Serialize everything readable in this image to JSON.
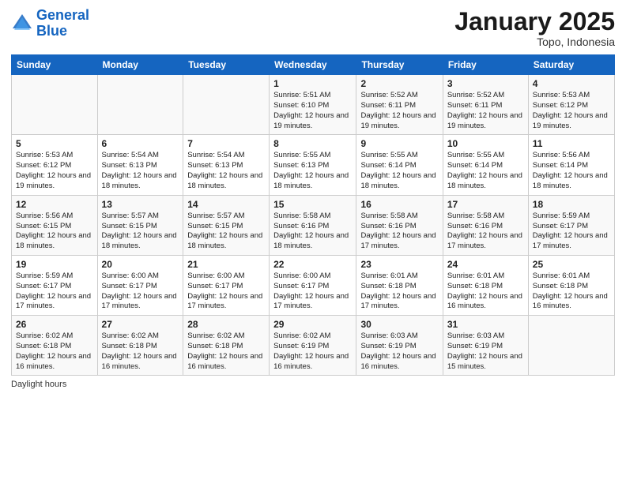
{
  "logo": {
    "line1": "General",
    "line2": "Blue"
  },
  "title": "January 2025",
  "subtitle": "Topo, Indonesia",
  "days_header": [
    "Sunday",
    "Monday",
    "Tuesday",
    "Wednesday",
    "Thursday",
    "Friday",
    "Saturday"
  ],
  "weeks": [
    [
      {
        "day": "",
        "detail": ""
      },
      {
        "day": "",
        "detail": ""
      },
      {
        "day": "",
        "detail": ""
      },
      {
        "day": "1",
        "detail": "Sunrise: 5:51 AM\nSunset: 6:10 PM\nDaylight: 12 hours\nand 19 minutes."
      },
      {
        "day": "2",
        "detail": "Sunrise: 5:52 AM\nSunset: 6:11 PM\nDaylight: 12 hours\nand 19 minutes."
      },
      {
        "day": "3",
        "detail": "Sunrise: 5:52 AM\nSunset: 6:11 PM\nDaylight: 12 hours\nand 19 minutes."
      },
      {
        "day": "4",
        "detail": "Sunrise: 5:53 AM\nSunset: 6:12 PM\nDaylight: 12 hours\nand 19 minutes."
      }
    ],
    [
      {
        "day": "5",
        "detail": "Sunrise: 5:53 AM\nSunset: 6:12 PM\nDaylight: 12 hours\nand 19 minutes."
      },
      {
        "day": "6",
        "detail": "Sunrise: 5:54 AM\nSunset: 6:13 PM\nDaylight: 12 hours\nand 18 minutes."
      },
      {
        "day": "7",
        "detail": "Sunrise: 5:54 AM\nSunset: 6:13 PM\nDaylight: 12 hours\nand 18 minutes."
      },
      {
        "day": "8",
        "detail": "Sunrise: 5:55 AM\nSunset: 6:13 PM\nDaylight: 12 hours\nand 18 minutes."
      },
      {
        "day": "9",
        "detail": "Sunrise: 5:55 AM\nSunset: 6:14 PM\nDaylight: 12 hours\nand 18 minutes."
      },
      {
        "day": "10",
        "detail": "Sunrise: 5:55 AM\nSunset: 6:14 PM\nDaylight: 12 hours\nand 18 minutes."
      },
      {
        "day": "11",
        "detail": "Sunrise: 5:56 AM\nSunset: 6:14 PM\nDaylight: 12 hours\nand 18 minutes."
      }
    ],
    [
      {
        "day": "12",
        "detail": "Sunrise: 5:56 AM\nSunset: 6:15 PM\nDaylight: 12 hours\nand 18 minutes."
      },
      {
        "day": "13",
        "detail": "Sunrise: 5:57 AM\nSunset: 6:15 PM\nDaylight: 12 hours\nand 18 minutes."
      },
      {
        "day": "14",
        "detail": "Sunrise: 5:57 AM\nSunset: 6:15 PM\nDaylight: 12 hours\nand 18 minutes."
      },
      {
        "day": "15",
        "detail": "Sunrise: 5:58 AM\nSunset: 6:16 PM\nDaylight: 12 hours\nand 18 minutes."
      },
      {
        "day": "16",
        "detail": "Sunrise: 5:58 AM\nSunset: 6:16 PM\nDaylight: 12 hours\nand 17 minutes."
      },
      {
        "day": "17",
        "detail": "Sunrise: 5:58 AM\nSunset: 6:16 PM\nDaylight: 12 hours\nand 17 minutes."
      },
      {
        "day": "18",
        "detail": "Sunrise: 5:59 AM\nSunset: 6:17 PM\nDaylight: 12 hours\nand 17 minutes."
      }
    ],
    [
      {
        "day": "19",
        "detail": "Sunrise: 5:59 AM\nSunset: 6:17 PM\nDaylight: 12 hours\nand 17 minutes."
      },
      {
        "day": "20",
        "detail": "Sunrise: 6:00 AM\nSunset: 6:17 PM\nDaylight: 12 hours\nand 17 minutes."
      },
      {
        "day": "21",
        "detail": "Sunrise: 6:00 AM\nSunset: 6:17 PM\nDaylight: 12 hours\nand 17 minutes."
      },
      {
        "day": "22",
        "detail": "Sunrise: 6:00 AM\nSunset: 6:17 PM\nDaylight: 12 hours\nand 17 minutes."
      },
      {
        "day": "23",
        "detail": "Sunrise: 6:01 AM\nSunset: 6:18 PM\nDaylight: 12 hours\nand 17 minutes."
      },
      {
        "day": "24",
        "detail": "Sunrise: 6:01 AM\nSunset: 6:18 PM\nDaylight: 12 hours\nand 16 minutes."
      },
      {
        "day": "25",
        "detail": "Sunrise: 6:01 AM\nSunset: 6:18 PM\nDaylight: 12 hours\nand 16 minutes."
      }
    ],
    [
      {
        "day": "26",
        "detail": "Sunrise: 6:02 AM\nSunset: 6:18 PM\nDaylight: 12 hours\nand 16 minutes."
      },
      {
        "day": "27",
        "detail": "Sunrise: 6:02 AM\nSunset: 6:18 PM\nDaylight: 12 hours\nand 16 minutes."
      },
      {
        "day": "28",
        "detail": "Sunrise: 6:02 AM\nSunset: 6:18 PM\nDaylight: 12 hours\nand 16 minutes."
      },
      {
        "day": "29",
        "detail": "Sunrise: 6:02 AM\nSunset: 6:19 PM\nDaylight: 12 hours\nand 16 minutes."
      },
      {
        "day": "30",
        "detail": "Sunrise: 6:03 AM\nSunset: 6:19 PM\nDaylight: 12 hours\nand 16 minutes."
      },
      {
        "day": "31",
        "detail": "Sunrise: 6:03 AM\nSunset: 6:19 PM\nDaylight: 12 hours\nand 15 minutes."
      },
      {
        "day": "",
        "detail": ""
      }
    ]
  ],
  "footer": {
    "label": "Daylight hours"
  }
}
